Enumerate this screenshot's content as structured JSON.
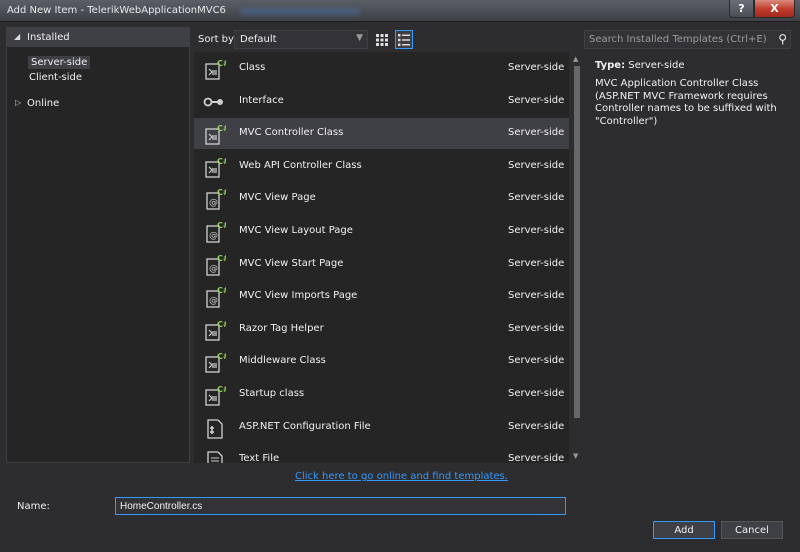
{
  "window": {
    "title": "Add New Item - TelerikWebApplicationMVC6",
    "help_label": "?",
    "close_label": "X"
  },
  "toolbar": {
    "sort_label": "Sort by:",
    "sort_value": "Default",
    "search_placeholder": "Search Installed Templates (Ctrl+E)"
  },
  "left_panel": {
    "installed_label": "Installed",
    "items": [
      {
        "label": "Server-side",
        "selected": true
      },
      {
        "label": "Client-side",
        "selected": false
      }
    ],
    "online_label": "Online"
  },
  "templates": [
    {
      "name": "Class",
      "category": "Server-side",
      "icon": "cs-class-icon"
    },
    {
      "name": "Interface",
      "category": "Server-side",
      "icon": "interface-icon"
    },
    {
      "name": "MVC Controller Class",
      "category": "Server-side",
      "icon": "cs-class-icon",
      "selected": true
    },
    {
      "name": "Web API Controller Class",
      "category": "Server-side",
      "icon": "cs-class-icon"
    },
    {
      "name": "MVC View Page",
      "category": "Server-side",
      "icon": "razor-page-icon"
    },
    {
      "name": "MVC View Layout Page",
      "category": "Server-side",
      "icon": "razor-page-icon"
    },
    {
      "name": "MVC View Start Page",
      "category": "Server-side",
      "icon": "razor-page-icon"
    },
    {
      "name": "MVC View Imports Page",
      "category": "Server-side",
      "icon": "razor-page-icon"
    },
    {
      "name": "Razor Tag Helper",
      "category": "Server-side",
      "icon": "cs-class-icon"
    },
    {
      "name": "Middleware Class",
      "category": "Server-side",
      "icon": "cs-class-icon"
    },
    {
      "name": "Startup class",
      "category": "Server-side",
      "icon": "cs-class-icon"
    },
    {
      "name": "ASP.NET Configuration File",
      "category": "Server-side",
      "icon": "config-file-icon"
    },
    {
      "name": "Text File",
      "category": "Server-side",
      "icon": "text-file-icon"
    }
  ],
  "online_link": "Click here to go online and find templates.",
  "details": {
    "type_label": "Type:",
    "type_value": "Server-side",
    "description": "MVC Application Controller Class (ASP.NET MVC Framework requires Controller names to be suffixed with \"Controller\")"
  },
  "footer": {
    "name_label": "Name:",
    "name_value": "HomeController.cs",
    "add_label": "Add",
    "cancel_label": "Cancel"
  },
  "colors": {
    "background": "#2d2d30",
    "panel": "#252526",
    "selection": "#3f3f46",
    "accent": "#3399ff",
    "csharp_green": "#8fd45c"
  }
}
